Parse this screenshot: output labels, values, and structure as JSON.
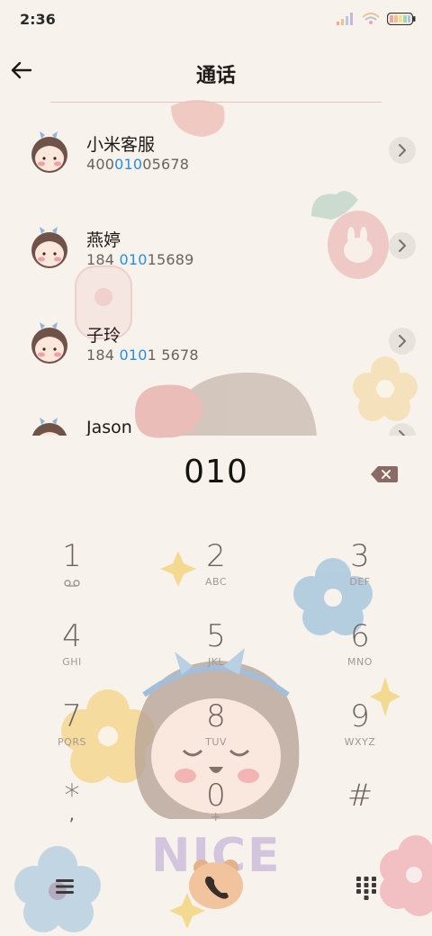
{
  "status_bar": {
    "time": "2:36"
  },
  "header": {
    "title": "通话"
  },
  "contacts": [
    {
      "name": "小米客服",
      "num_pre": "400",
      "num_hl": "010",
      "num_post": "05678"
    },
    {
      "name": "燕婷",
      "num_pre": "184 ",
      "num_hl": "010",
      "num_post": "15689"
    },
    {
      "name": "子玲",
      "num_pre": "184 ",
      "num_hl": "010",
      "num_post": "1 5678"
    },
    {
      "name": "Jason",
      "num_pre": "",
      "num_hl": "",
      "num_post": ""
    }
  ],
  "dialer": {
    "number": "010"
  },
  "keypad": [
    {
      "digit": "1",
      "letters": ""
    },
    {
      "digit": "2",
      "letters": "ABC"
    },
    {
      "digit": "3",
      "letters": "DEF"
    },
    {
      "digit": "4",
      "letters": "GHI"
    },
    {
      "digit": "5",
      "letters": "JKL"
    },
    {
      "digit": "6",
      "letters": "MNO"
    },
    {
      "digit": "7",
      "letters": "PQRS"
    },
    {
      "digit": "8",
      "letters": "TUV"
    },
    {
      "digit": "9",
      "letters": "WXYZ"
    },
    {
      "digit": "*",
      "letters": ","
    },
    {
      "digit": "0",
      "letters": "+"
    },
    {
      "digit": "#",
      "letters": ""
    }
  ],
  "decoration": {
    "text": "NICE"
  },
  "colors": {
    "highlight": "#2a8ee0",
    "background": "#f8f2ec",
    "key_digit": "#6e6260"
  }
}
